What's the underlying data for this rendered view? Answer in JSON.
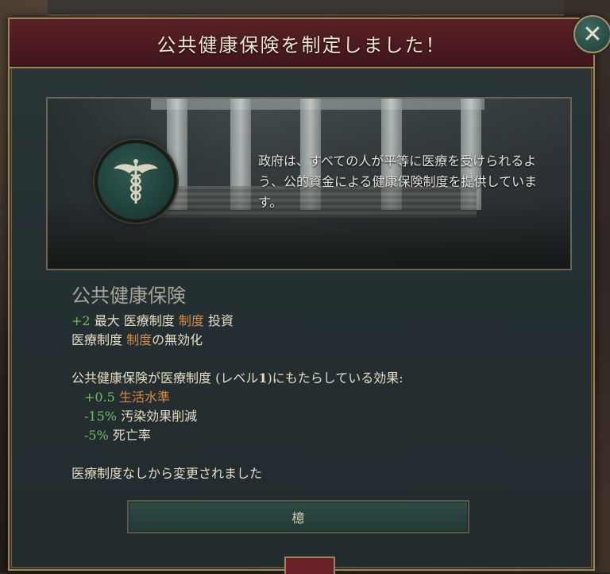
{
  "header": {
    "title": "公共健康保険を制定しました！"
  },
  "close_button": {
    "label": "✕"
  },
  "banner": {
    "emblem_icon": "caduceus-icon",
    "description": "政府は、すべての人が平等に医療を受けられるよう、公的資金による健康保険制度を提供しています。"
  },
  "law": {
    "name": "公共健康保険",
    "effects": [
      {
        "value": "+2",
        "parts": [
          "最大",
          "医療制度",
          "制度",
          "投資"
        ]
      },
      {
        "value": "",
        "parts": [
          "医療制度",
          "制度",
          "の無効化"
        ]
      }
    ],
    "institution_header": {
      "prefix": "公共健康保険が医療制度 (レベル",
      "level": "1",
      "suffix": ")にもたらしている効果:"
    },
    "institution_effects": [
      {
        "value": "+0.5",
        "label": "生活水準"
      },
      {
        "value": "-15%",
        "label": "汚染効果削減"
      },
      {
        "value": "-5%",
        "label": "死亡率"
      }
    ],
    "change_note": "医療制度なしから変更されました"
  },
  "ok_button": {
    "label": "檍"
  },
  "colors": {
    "header_bg": "#4a1a20",
    "panel_bg": "#253033",
    "positive": "#6fbf5a",
    "highlight": "#d88840",
    "gold_border": "#9c8658"
  }
}
